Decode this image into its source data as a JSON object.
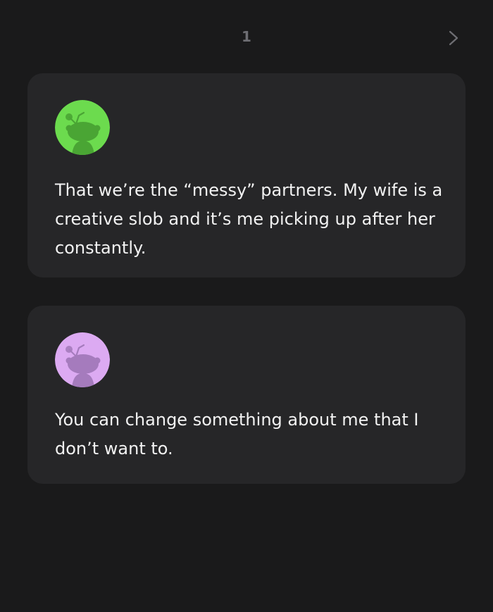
{
  "pager": {
    "page_number": "1",
    "next_icon": "chevron-right-icon"
  },
  "comments": [
    {
      "avatar_icon": "snoo-avatar-icon",
      "avatar_color": "#6cdb4e",
      "avatar_figure_color": "#4aa534",
      "text": "That we’re the “messy” partners. My wife is a creative slob and it’s me picking up after her constantly."
    },
    {
      "avatar_icon": "snoo-avatar-icon",
      "avatar_color": "#dcaaf2",
      "avatar_figure_color": "#a57bbd",
      "text": "You can change something about me that I don’t want to."
    }
  ],
  "colors": {
    "background": "#1a1a1b",
    "card": "#262628",
    "text": "#f2f2f2",
    "muted": "#6e6e73"
  }
}
